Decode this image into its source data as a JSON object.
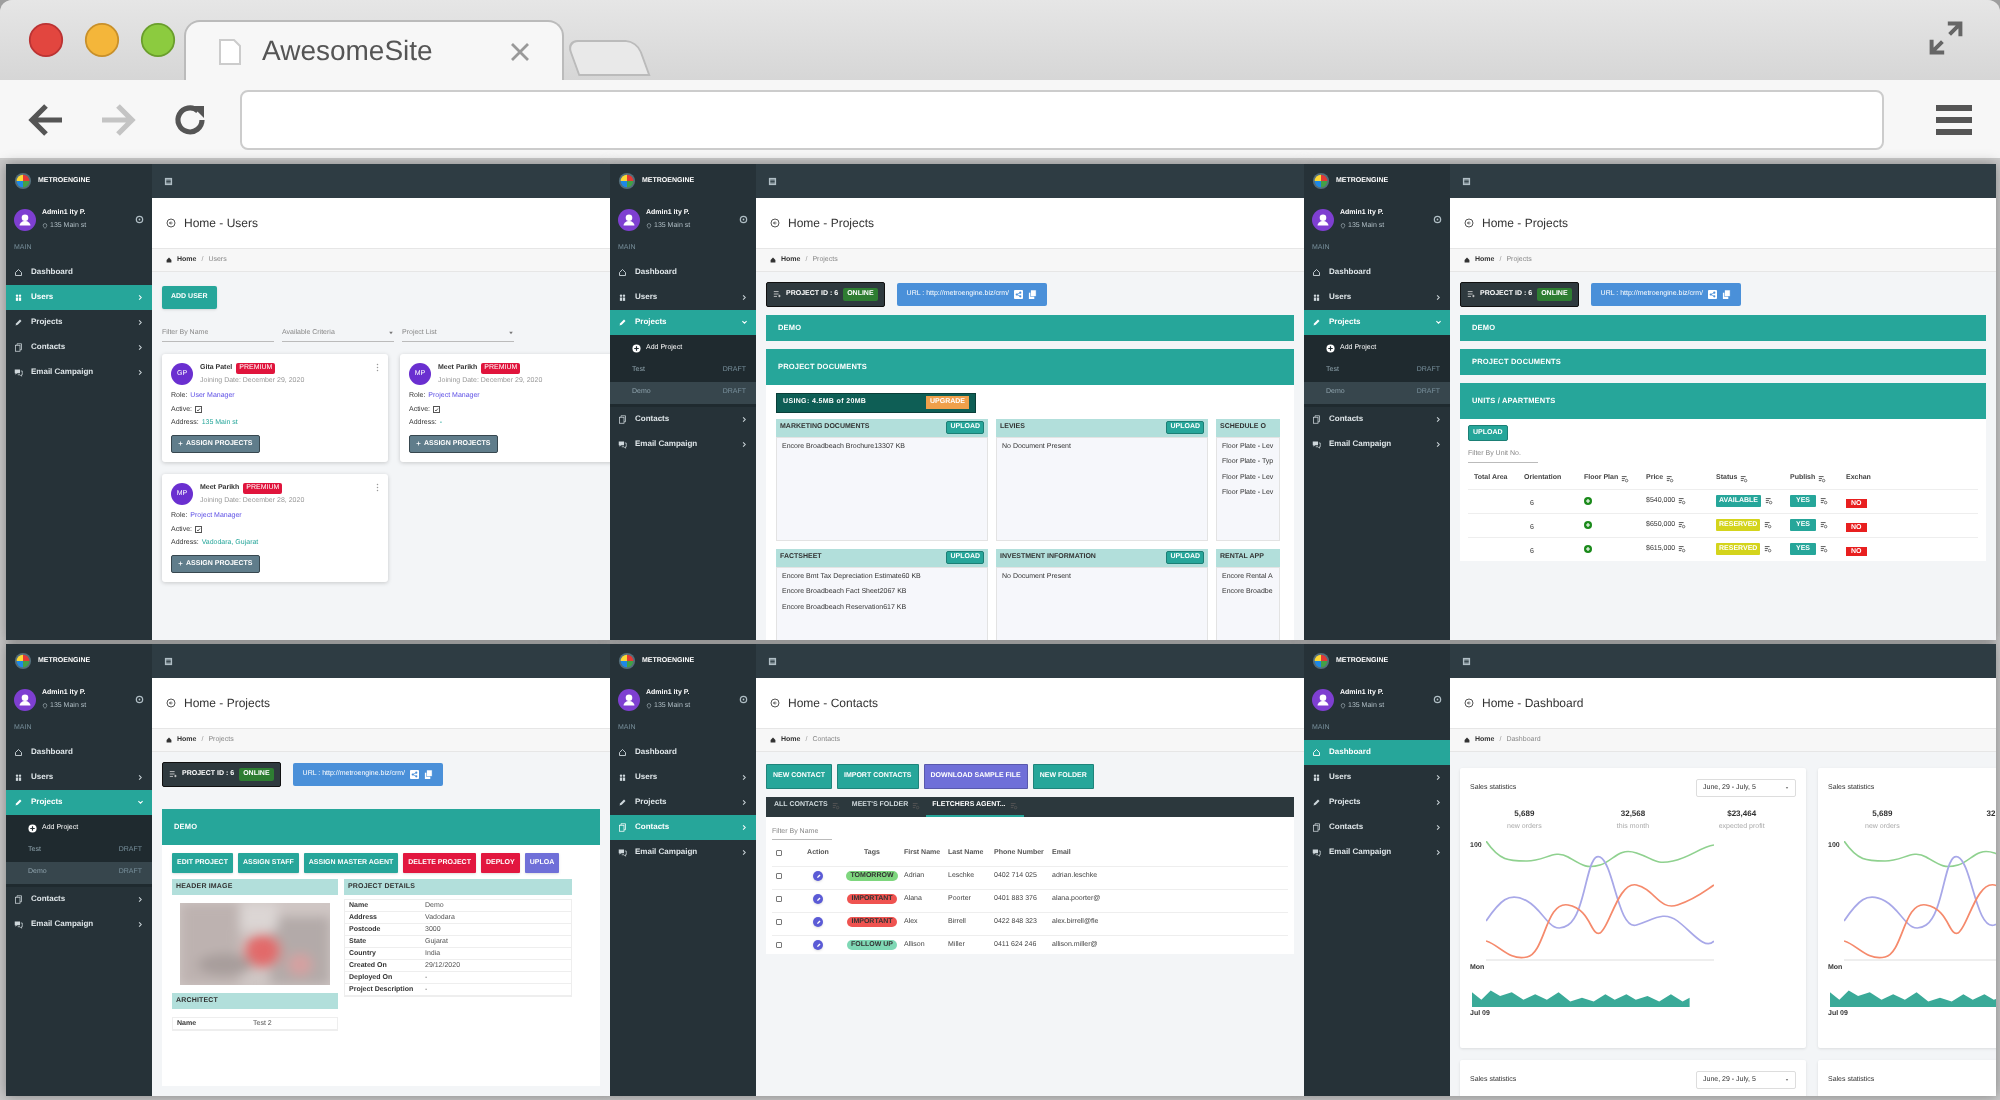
{
  "browser": {
    "tab_title": "AwesomeSite",
    "forward_disabled": true
  },
  "screens": [
    {
      "kind": "users",
      "brand": "METROENGINE",
      "user": {
        "name": "Admin1 ity P.",
        "address": "135 Main st"
      },
      "section": "MAIN",
      "nav": [
        {
          "label": "Dashboard",
          "selected": false
        },
        {
          "label": "Users",
          "selected": true,
          "expanded": false
        },
        {
          "label": "Projects",
          "selected": false,
          "expanded": false
        },
        {
          "label": "Contacts",
          "selected": false,
          "expanded": false
        },
        {
          "label": "Email Campaign",
          "selected": false,
          "expanded": false
        }
      ],
      "title": "Home - Users",
      "breadcrumb": [
        "Home",
        "/",
        "Users"
      ],
      "add_button": "ADD USER",
      "filters": [
        {
          "kind": "text",
          "placeholder": "Filter By Name"
        },
        {
          "kind": "select",
          "placeholder": "Available Criteria"
        },
        {
          "kind": "select",
          "placeholder": "Project List"
        }
      ],
      "cards": [
        {
          "initials": "GP",
          "name": "Gita Patel",
          "badge": "PREMIUM",
          "joined": "Joining Date: December 29, 2020",
          "fields": [
            {
              "kind": "role",
              "label": "Role:",
              "value": "User Manager"
            },
            {
              "kind": "check",
              "label": "Active:",
              "checked": true
            },
            {
              "kind": "address",
              "label": "Address:",
              "value": "135 Main st"
            }
          ],
          "button": "ASSIGN PROJECTS"
        },
        {
          "initials": "MP",
          "name": "Meet Parikh",
          "badge": "PREMIUM",
          "joined": "Joining Date: December 29, 2020",
          "fields": [
            {
              "kind": "role",
              "label": "Role:",
              "value": "Project Manager"
            },
            {
              "kind": "check",
              "label": "Active:",
              "checked": true
            },
            {
              "kind": "address",
              "label": "Address:",
              "value": "-"
            }
          ],
          "button": "ASSIGN PROJECTS"
        },
        {
          "initials": "MP",
          "name": "Meet Parikh",
          "badge": "PREMIUM",
          "joined": "Joining Date: December 28, 2020",
          "fields": [
            {
              "kind": "role",
              "label": "Role:",
              "value": "Project Manager"
            },
            {
              "kind": "check",
              "label": "Active:",
              "checked": true
            },
            {
              "kind": "address",
              "label": "Address:",
              "value": "Vadodara, Gujarat"
            }
          ],
          "button": "ASSIGN PROJECTS"
        }
      ]
    },
    {
      "kind": "documents",
      "brand": "METROENGINE",
      "user": {
        "name": "Admin1 ity P.",
        "address": "135 Main st"
      },
      "section": "MAIN",
      "nav": [
        {
          "label": "Dashboard",
          "selected": false
        },
        {
          "label": "Users",
          "selected": false,
          "expanded": false
        },
        {
          "label": "Projects",
          "selected": true,
          "expanded": true,
          "children": [
            {
              "kind": "action",
              "label": "Add Project",
              "selected": false
            },
            {
              "kind": "project",
              "label": "Test",
              "badge": "DRAFT",
              "selected": false
            },
            {
              "kind": "project",
              "label": "Demo",
              "badge": "DRAFT",
              "selected": true
            }
          ]
        },
        {
          "label": "Contacts",
          "selected": false,
          "expanded": false
        },
        {
          "label": "Email Campaign",
          "selected": false,
          "expanded": false
        }
      ],
      "title": "Home - Projects",
      "breadcrumb": [
        "Home",
        "/",
        "Projects"
      ],
      "project_bar": {
        "id_label": "PROJECT ID : 6",
        "status": "ONLINE",
        "url": "URL : http://metroengine.biz/crm/"
      },
      "sections": [
        "DEMO",
        "PROJECT DOCUMENTS"
      ],
      "usage": {
        "text": "USING: 4.5MB of 20MB",
        "button": "UPGRADE"
      },
      "boxes": [
        {
          "title": "MARKETING DOCUMENTS",
          "button": "UPLOAD",
          "files": [
            "Encore Broadbeach Brochure13307 KB"
          ]
        },
        {
          "title": "LEVIES",
          "button": "UPLOAD",
          "files": [
            "No Document Present"
          ]
        },
        {
          "title": "SCHEDULE O",
          "files": [
            "Floor Plate - Lev",
            "Floor Plate - Typ",
            "Floor Plate - Lev",
            "Floor Plate - Lev"
          ]
        },
        {
          "title": "FACTSHEET",
          "button": "UPLOAD",
          "files": [
            "Encore Bmt Tax Depreciation Estimate60 KB",
            "Encore Broadbeach Fact Sheet2067 KB",
            "Encore Broadbeach Reservation617 KB"
          ]
        },
        {
          "title": "INVESTMENT INFORMATION",
          "button": "UPLOAD",
          "files": [
            "No Document Present"
          ]
        },
        {
          "title": "RENTAL APP",
          "files": [
            "Encore Rental A",
            "Encore Broadbe"
          ]
        }
      ]
    },
    {
      "kind": "units",
      "brand": "METROENGINE",
      "user": {
        "name": "Admin1 ity P.",
        "address": "135 Main st"
      },
      "section": "MAIN",
      "nav": [
        {
          "label": "Dashboard",
          "selected": false
        },
        {
          "label": "Users",
          "selected": false,
          "expanded": false
        },
        {
          "label": "Projects",
          "selected": true,
          "expanded": true,
          "children": [
            {
              "kind": "action",
              "label": "Add Project",
              "selected": false
            },
            {
              "kind": "project",
              "label": "Test",
              "badge": "DRAFT",
              "selected": false
            },
            {
              "kind": "project",
              "label": "Demo",
              "badge": "DRAFT",
              "selected": true
            }
          ]
        },
        {
          "label": "Contacts",
          "selected": false,
          "expanded": false
        },
        {
          "label": "Email Campaign",
          "selected": false,
          "expanded": false
        }
      ],
      "title": "Home - Projects",
      "breadcrumb": [
        "Home",
        "/",
        "Projects"
      ],
      "project_bar": {
        "id_label": "PROJECT ID : 6",
        "status": "ONLINE",
        "url": "URL : http://metroengine.biz/crm/"
      },
      "sections": [
        "DEMO",
        "PROJECT DOCUMENTS",
        "UNITS / APARTMENTS"
      ],
      "upload_button": "UPLOAD",
      "filter_placeholder": "Filter By Unit No.",
      "columns": [
        {
          "label": "Total Area",
          "filter": false
        },
        {
          "label": "Orientation",
          "filter": false
        },
        {
          "label": "Floor Plan",
          "filter": true
        },
        {
          "label": "Price",
          "filter": true
        },
        {
          "label": "Status",
          "filter": true
        },
        {
          "label": "Publish",
          "filter": true
        },
        {
          "label": "Exchan",
          "filter": false
        }
      ],
      "rows": [
        {
          "orientation": "6",
          "price": "$540,000",
          "status": {
            "label": "AVAILABLE",
            "kind": "available"
          },
          "publish": "YES",
          "exchange": "NO"
        },
        {
          "orientation": "6",
          "price": "$650,000",
          "status": {
            "label": "RESERVED",
            "kind": "reserved"
          },
          "publish": "YES",
          "exchange": "NO"
        },
        {
          "orientation": "6",
          "price": "$615,000",
          "status": {
            "label": "RESERVED",
            "kind": "reserved"
          },
          "publish": "YES",
          "exchange": "NO"
        }
      ]
    },
    {
      "kind": "detail",
      "brand": "METROENGINE",
      "user": {
        "name": "Admin1 ity P.",
        "address": "135 Main st"
      },
      "section": "MAIN",
      "nav": [
        {
          "label": "Dashboard",
          "selected": false
        },
        {
          "label": "Users",
          "selected": false,
          "expanded": false
        },
        {
          "label": "Projects",
          "selected": true,
          "expanded": true,
          "children": [
            {
              "kind": "action",
              "label": "Add Project",
              "selected": false
            },
            {
              "kind": "project",
              "label": "Test",
              "badge": "DRAFT",
              "selected": false
            },
            {
              "kind": "project",
              "label": "Demo",
              "badge": "DRAFT",
              "selected": true
            }
          ]
        },
        {
          "label": "Contacts",
          "selected": false,
          "expanded": false
        },
        {
          "label": "Email Campaign",
          "selected": false,
          "expanded": false
        }
      ],
      "title": "Home - Projects",
      "breadcrumb": [
        "Home",
        "/",
        "Projects"
      ],
      "project_bar": {
        "id_label": "PROJECT ID : 6",
        "status": "ONLINE",
        "url": "URL : http://metroengine.biz/crm/"
      },
      "sections": [
        "DEMO"
      ],
      "actions": [
        {
          "label": "EDIT PROJECT",
          "kind": "primary"
        },
        {
          "label": "ASSIGN STAFF",
          "kind": "primary"
        },
        {
          "label": "ASSIGN MASTER AGENT",
          "kind": "primary"
        },
        {
          "label": "DELETE PROJECT",
          "kind": "danger"
        },
        {
          "label": "DEPLOY",
          "kind": "danger"
        },
        {
          "label": "UPLOA",
          "kind": "info"
        }
      ],
      "image_title": "HEADER IMAGE",
      "details_title": "PROJECT DETAILS",
      "details": [
        [
          "Name",
          "Demo"
        ],
        [
          "Address",
          "Vadodara"
        ],
        [
          "Postcode",
          "3000"
        ],
        [
          "State",
          "Gujarat"
        ],
        [
          "Country",
          "India"
        ],
        [
          "Created On",
          "29/12/2020"
        ],
        [
          "Deployed On",
          "-"
        ],
        [
          "Project Description",
          "-"
        ]
      ],
      "architect_title": "ARCHITECT",
      "architect": [
        [
          "Name",
          "Test 2"
        ]
      ]
    },
    {
      "kind": "contacts",
      "brand": "METROENGINE",
      "user": {
        "name": "Admin1 ity P.",
        "address": "135 Main st"
      },
      "section": "MAIN",
      "nav": [
        {
          "label": "Dashboard",
          "selected": false
        },
        {
          "label": "Users",
          "selected": false,
          "expanded": false
        },
        {
          "label": "Projects",
          "selected": false,
          "expanded": false
        },
        {
          "label": "Contacts",
          "selected": true,
          "expanded": false
        },
        {
          "label": "Email Campaign",
          "selected": false,
          "expanded": false
        }
      ],
      "title": "Home - Contacts",
      "breadcrumb": [
        "Home",
        "/",
        "Contacts"
      ],
      "buttons": [
        {
          "label": "NEW CONTACT",
          "kind": "primary"
        },
        {
          "label": "IMPORT CONTACTS",
          "kind": "primary"
        },
        {
          "label": "DOWNLOAD SAMPLE FILE",
          "kind": "info"
        },
        {
          "label": "NEW FOLDER",
          "kind": "primary"
        }
      ],
      "tabs": [
        {
          "label": "ALL CONTACTS",
          "selected": false
        },
        {
          "label": "MEET'S FOLDER",
          "selected": false
        },
        {
          "label": "FLETCHERS AGENT...",
          "selected": true
        }
      ],
      "filter_placeholder": "Filter By Name",
      "select_all_checked": false,
      "columns": [
        "Action",
        "Tags",
        "First Name",
        "Last Name",
        "Phone Number",
        "Email"
      ],
      "rows": [
        {
          "checked": false,
          "tag": "TOMORROW",
          "color": "#7ed67e",
          "first": "Adrian",
          "last": "Leschke",
          "phone": "0402 714 025",
          "email": "adrian.leschke"
        },
        {
          "checked": false,
          "tag": "IMPORTANT",
          "color": "#ef5350",
          "first": "Alana",
          "last": "Poorter",
          "phone": "0401 883 376",
          "email": "alana.poorter@"
        },
        {
          "checked": false,
          "tag": "IMPORTANT",
          "color": "#ef5350",
          "first": "Alex",
          "last": "Birrell",
          "phone": "0422 848 323",
          "email": "alex.birrell@fle"
        },
        {
          "checked": false,
          "tag": "FOLLOW UP",
          "color": "#7fd8b5",
          "first": "Allison",
          "last": "Miller",
          "phone": "0411 624 246",
          "email": "allison.miller@"
        }
      ]
    },
    {
      "kind": "dashboard",
      "brand": "METROENGINE",
      "user": {
        "name": "Admin1 ity P.",
        "address": "135 Main st"
      },
      "section": "MAIN",
      "nav": [
        {
          "label": "Dashboard",
          "selected": true
        },
        {
          "label": "Users",
          "selected": false,
          "expanded": false
        },
        {
          "label": "Projects",
          "selected": false,
          "expanded": false
        },
        {
          "label": "Contacts",
          "selected": false,
          "expanded": false
        },
        {
          "label": "Email Campaign",
          "selected": false,
          "expanded": false
        }
      ],
      "title": "Home - Dashboard",
      "breadcrumb": [
        "Home",
        "/",
        "Dashboard"
      ],
      "cards": [
        {
          "title": "Sales statistics",
          "range": "June, 29 - July, 5",
          "stats": [
            {
              "value": "5,689",
              "label": "new orders"
            },
            {
              "value": "32,568",
              "label": "this month"
            },
            {
              "value": "$23,464",
              "label": "expected profit"
            }
          ],
          "y_tick": "100",
          "x_tick": "Mon",
          "area_label": "Jul 09"
        },
        {
          "title": "Sales statistics",
          "stats": [
            {
              "value": "5,689",
              "label": "new orders"
            },
            {
              "value": "32"
            }
          ],
          "y_tick": "100",
          "x_tick": "Mon",
          "area_label": "Jul 09"
        },
        {
          "title": "Sales statistics",
          "range": "June, 29 - July, 5"
        },
        {
          "title": "Sales statistics"
        }
      ]
    }
  ]
}
